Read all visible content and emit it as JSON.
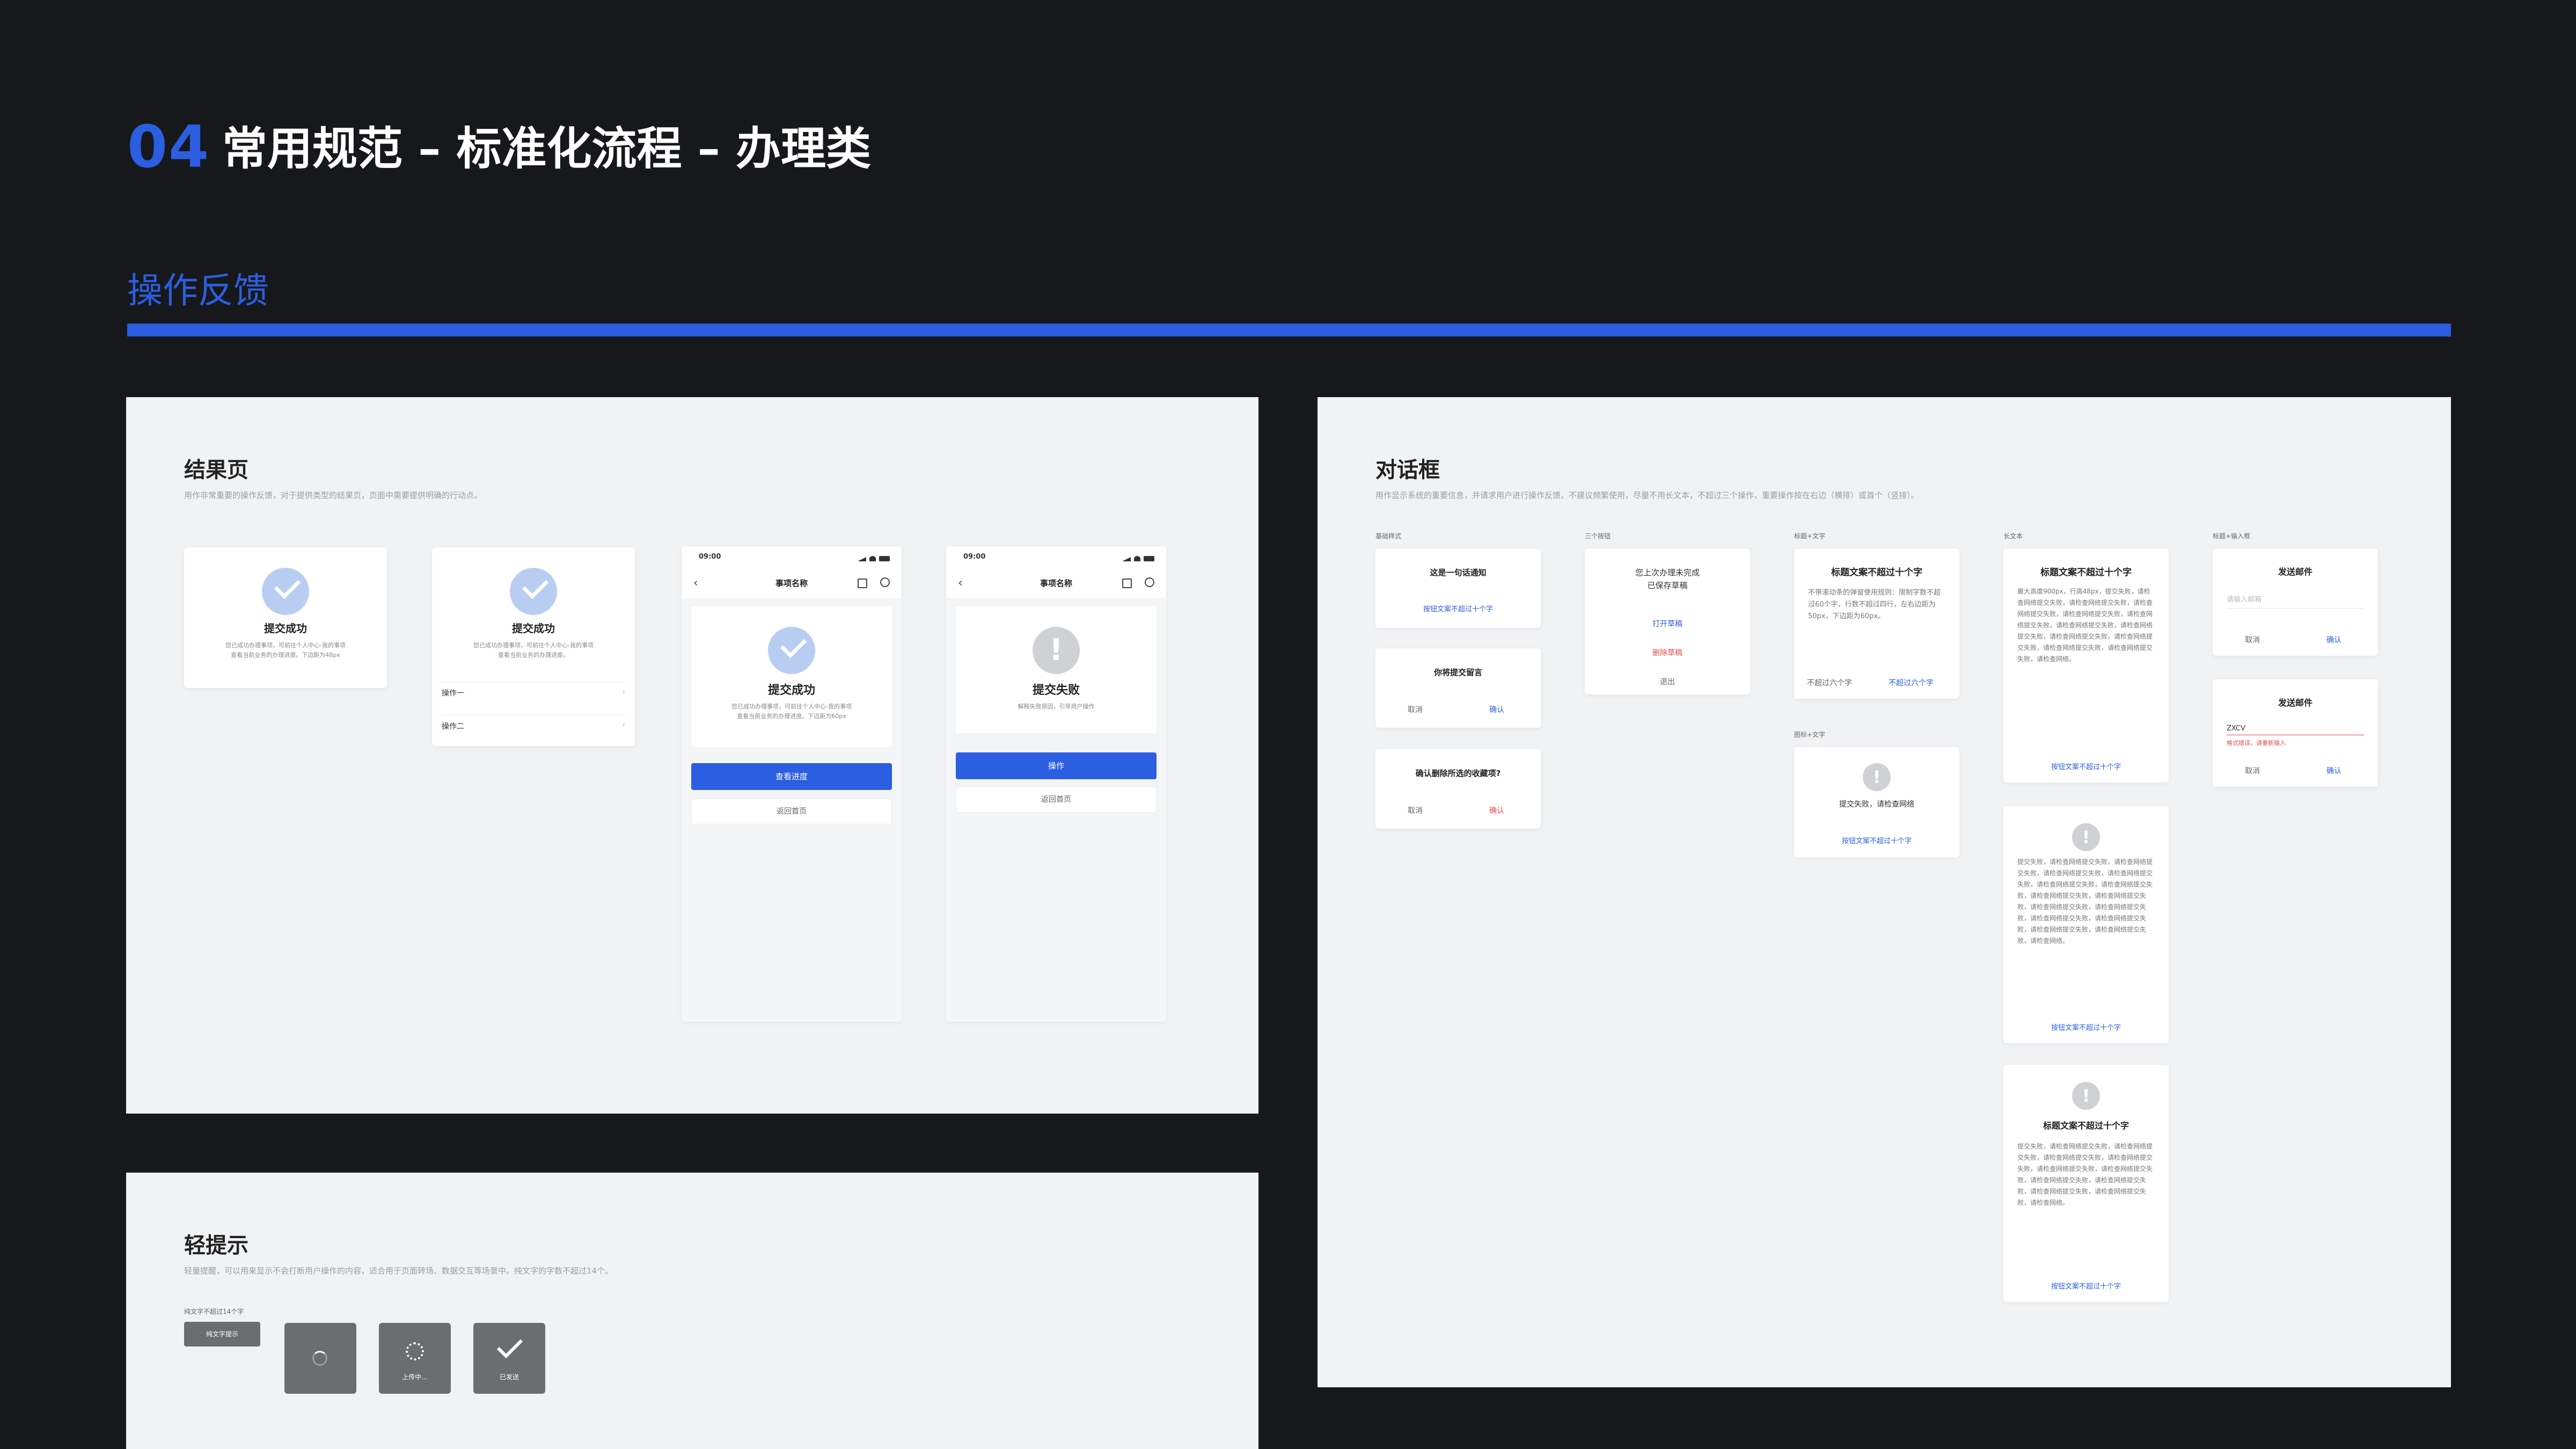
{
  "header": {
    "number": "04",
    "title": "常用规范 – 标准化流程 – 办理类"
  },
  "section": {
    "title": "操作反馈"
  },
  "result_panel": {
    "title": "结果页",
    "desc": "用作非常重要的操作反馈，对于提供类型的结果页，页面中需要提供明确的行动点。",
    "cards": [
      {
        "title": "提交成功",
        "desc1": "您已成功办理事项，可前往个人中心-我的事项",
        "desc2": "查看当前业务的办理进度。下边距为48px"
      },
      {
        "title": "提交成功",
        "desc1": "您已成功办理事项，可前往个人中心-我的事项",
        "desc2": "查看当前业务的办理进度。",
        "op1": "操作一",
        "op2": "操作二"
      }
    ],
    "phones": [
      {
        "time": "09:00",
        "nav": "事项名称",
        "title": "提交成功",
        "desc1": "您已成功办理事项，可前往个人中心-我的事项",
        "desc2": "查看当前业务的办理进度。下边距为60px",
        "primary": "查看进度",
        "secondary": "返回首页"
      },
      {
        "time": "09:00",
        "nav": "事项名称",
        "title": "提交失败",
        "desc1": "解释失败原因，引导用户操作",
        "primary": "操作",
        "secondary": "返回首页"
      }
    ]
  },
  "dialog_panel": {
    "title": "对话框",
    "desc": "用作显示系统的重要信息，并请求用户进行操作反馈。不建议频繁使用，尽量不用长文本，不超过三个操作，重要操作按在右边（横排）或首个（竖排）。",
    "groups": {
      "basic": "基础样式",
      "three": "三个按钮",
      "title_text": "标题+文字",
      "long_text": "长文本",
      "title_input": "标题+输入框",
      "icon_text": "图标+文字"
    },
    "basic": [
      {
        "title": "这是一句话通知",
        "link": "按钮文案不超过十个字"
      },
      {
        "title": "你将提交留言",
        "cancel": "取消",
        "confirm": "确认"
      },
      {
        "title": "确认删除所选的收藏项?",
        "cancel": "取消",
        "confirm": "确认"
      }
    ],
    "three": {
      "title1": "您上次办理未完成",
      "title2": "已保存草稿",
      "a1": "打开草稿",
      "a2": "删除草稿",
      "a3": "退出"
    },
    "title_text": {
      "title": "标题文案不超过十个字",
      "body": "不带滚动条的弹窗使用规则：限制字数不超过60个字，行数不超过四行，左右边距为50px，下边距为60px。",
      "left": "不超过六个字",
      "right": "不超过六个字"
    },
    "icon_text": {
      "title": "提交失败，请检查网络",
      "link": "按钮文案不超过十个字"
    },
    "long1": {
      "title": "标题文案不超过十个字",
      "body": "最大高度900px，行高48px，提交失败，请检查网络提交失败，请检查网络提交失败，请检查网络提交失败，请检查网络提交失败，请检查网络提交失败，请检查网络提交失败，请检查网络提交失败，请检查网络提交失败，请检查网络提交失败，请检查网络提交失败，请检查网络提交失败，请检查网络。",
      "link": "按钮文案不超过十个字"
    },
    "long2": {
      "body": "提交失败，请检查网络提交失败，请检查网络提交失败，请检查网络提交失败，请检查网络提交失败，请检查网络提交失败，请检查网络提交失败，请检查网络提交失败，请检查网络提交失败，请检查网络提交失败，请检查网络提交失败，请检查网络提交失败，请检查网络提交失败，请检查网络提交失败，请检查网络提交失败，请检查网络。",
      "link": "按钮文案不超过十个字"
    },
    "long3": {
      "title": "标题文案不超过十个字",
      "body": "提交失败，请检查网络提交失败，请检查网络提交失败，请检查网络提交失败，请检查网络提交失败，请检查网络提交失败，请检查网络提交失败，请检查网络提交失败，请检查网络提交失败，请检查网络提交失败，请检查网络提交失败，请检查网络。",
      "link": "按钮文案不超过十个字"
    },
    "input1": {
      "title": "发送邮件",
      "placeholder": "请输入邮箱",
      "cancel": "取消",
      "confirm": "确认"
    },
    "input2": {
      "title": "发送邮件",
      "value": "ZXCV",
      "error": "格式错误，请重新输入",
      "cancel": "取消",
      "confirm": "确认"
    }
  },
  "toast_panel": {
    "title": "轻提示",
    "desc": "轻量提醒，可以用来显示不会打断用户操作的内容，适合用于页面转场、数据交互等场景中。纯文字的字数不超过14个。",
    "label": "纯文字不超过14个字",
    "text_toast": "纯文字提示",
    "uploading": "上传中...",
    "sent": "已发送"
  }
}
